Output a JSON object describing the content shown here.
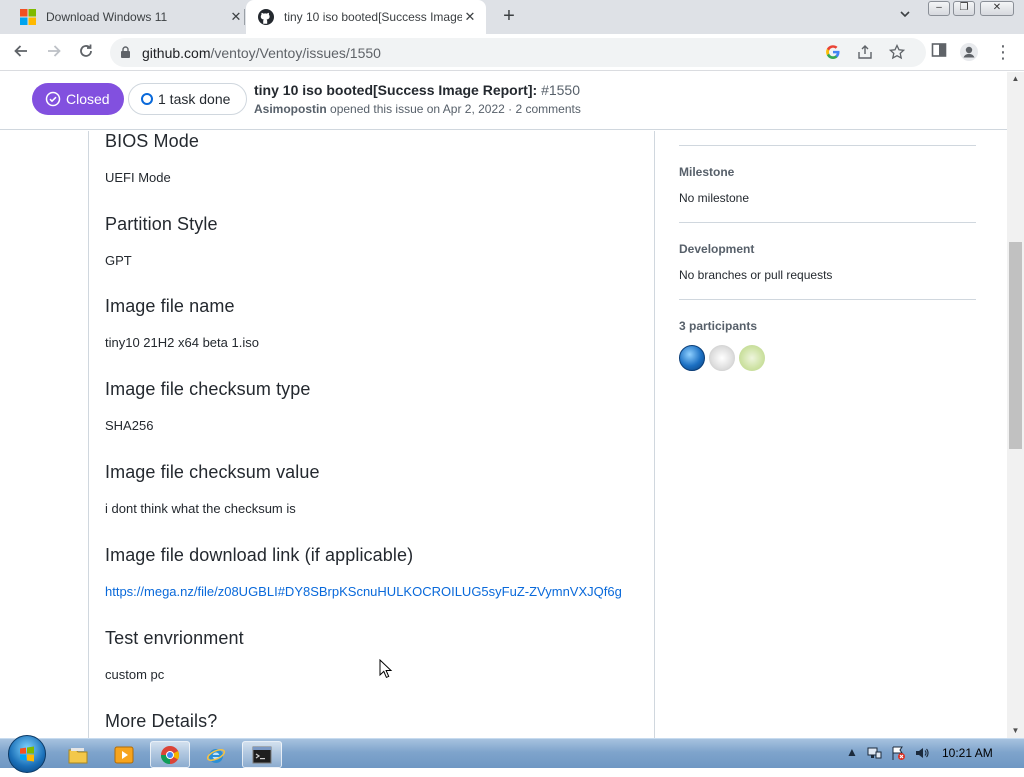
{
  "browser": {
    "tabs": [
      {
        "title": "Download Windows 11",
        "favicon": "windows-logo-icon"
      },
      {
        "title": "tiny 10 iso booted[Success Image Report]",
        "favicon": "github-icon",
        "active": true
      }
    ],
    "url_host": "github.com",
    "url_path": "/ventoy/Ventoy/issues/1550"
  },
  "issue": {
    "state": "Closed",
    "tasks": "1 task done",
    "title": "tiny 10 iso booted[Success Image Report]:",
    "number": "#1550",
    "author": "Asimopostin",
    "opened_text": "opened this issue on Apr 2, 2022 · 2 comments"
  },
  "body": {
    "sections": [
      {
        "heading": "BIOS Mode",
        "value": "UEFI Mode"
      },
      {
        "heading": "Partition Style",
        "value": "GPT"
      },
      {
        "heading": "Image file name",
        "value": "tiny10 21H2 x64 beta 1.iso"
      },
      {
        "heading": "Image file checksum type",
        "value": "SHA256"
      },
      {
        "heading": "Image file checksum value",
        "value": "i dont think what the checksum is"
      },
      {
        "heading": "Image file download link (if applicable)",
        "link": "https://mega.nz/file/z08UGBLI#DY8SBrpKScnuHULKOCROILUG5syFuZ-ZVymnVXJQf6g"
      },
      {
        "heading": "Test envrionment",
        "value": "custom pc"
      },
      {
        "heading": "More Details?"
      }
    ]
  },
  "sidebar": {
    "milestone_label": "Milestone",
    "milestone_value": "No milestone",
    "development_label": "Development",
    "development_value": "No branches or pull requests",
    "participants_label": "3 participants"
  },
  "taskbar": {
    "clock": "10:21 AM",
    "apps": [
      "file-explorer-icon",
      "media-player-icon",
      "chrome-icon",
      "internet-explorer-icon",
      "terminal-icon"
    ]
  },
  "colors": {
    "closed_badge": "#8250df",
    "link": "#0969da",
    "border": "#d0d7de"
  }
}
